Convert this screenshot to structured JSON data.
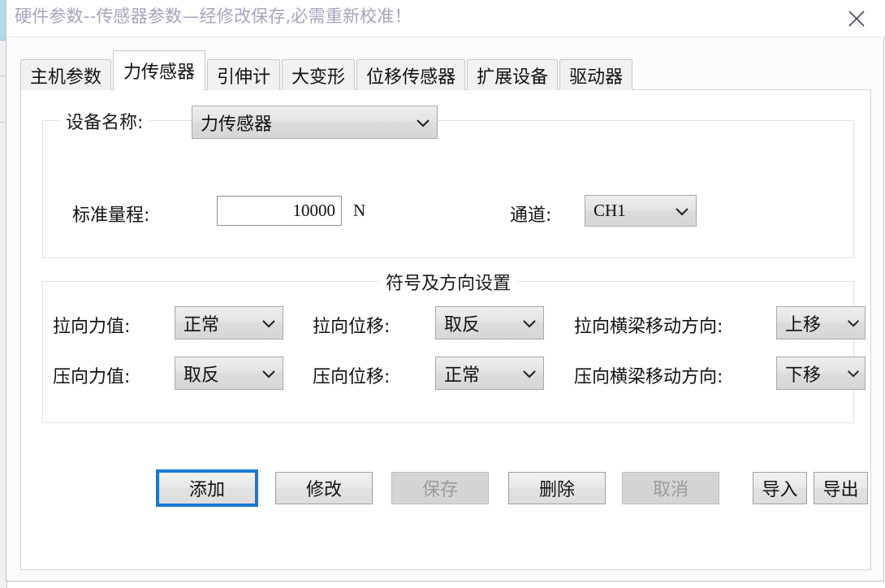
{
  "window": {
    "title": "硬件参数--传感器参数—经修改保存,必需重新校准！",
    "close_icon": "close-icon"
  },
  "tabs": [
    {
      "label": "主机参数",
      "active": false
    },
    {
      "label": "力传感器",
      "active": true
    },
    {
      "label": "引伸计",
      "active": false
    },
    {
      "label": "大变形",
      "active": false
    },
    {
      "label": "位移传感器",
      "active": false
    },
    {
      "label": "扩展设备",
      "active": false
    },
    {
      "label": "驱动器",
      "active": false
    }
  ],
  "device_group": {
    "legend": "设备名称:",
    "device_name_value": "力传感器",
    "range_label": "标准量程:",
    "range_value": "10000",
    "range_unit": "N",
    "channel_label": "通道:",
    "channel_value": "CH1"
  },
  "sign_group": {
    "legend": "符号及方向设置",
    "rows": [
      {
        "force_label": "拉向力值:",
        "force_value": "正常",
        "disp_label": "拉向位移:",
        "disp_value": "取反",
        "beam_label": "拉向横梁移动方向:",
        "beam_value": "上移"
      },
      {
        "force_label": "压向力值:",
        "force_value": "取反",
        "disp_label": "压向位移:",
        "disp_value": "正常",
        "beam_label": "压向横梁移动方向:",
        "beam_value": "下移"
      }
    ]
  },
  "buttons": [
    {
      "label": "添加",
      "state": "focused"
    },
    {
      "label": "修改",
      "state": "normal"
    },
    {
      "label": "保存",
      "state": "disabled"
    },
    {
      "label": "删除",
      "state": "normal"
    },
    {
      "label": "取消",
      "state": "disabled"
    },
    {
      "label": "导入",
      "state": "normal"
    },
    {
      "label": "导出",
      "state": "normal"
    }
  ],
  "colors": {
    "focus_blue": "#1878d2",
    "title_text": "#a9a3bd",
    "panel_bg": "#ffffff",
    "combo_bg": "#e3e3e3"
  }
}
